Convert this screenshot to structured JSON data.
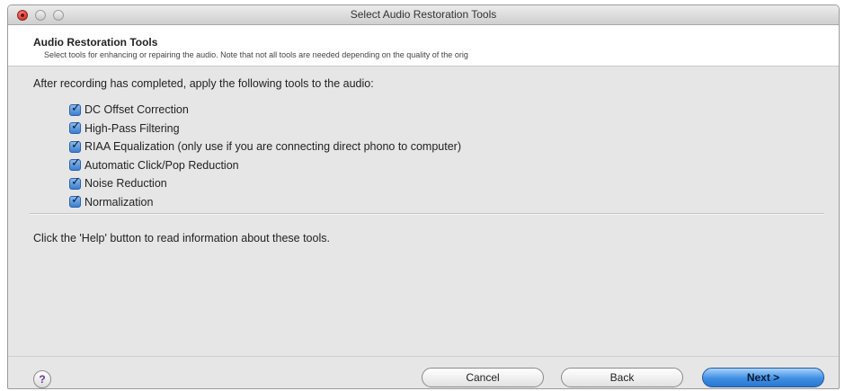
{
  "window": {
    "title": "Select Audio Restoration Tools"
  },
  "header": {
    "title": "Audio Restoration Tools",
    "subtitle": "Select tools for enhancing or repairing the audio. Note that not all tools are needed depending on the quality of the orig"
  },
  "instruction": "After recording has completed, apply the following tools to the audio:",
  "tools": [
    {
      "label": "DC Offset Correction",
      "checked": true
    },
    {
      "label": "High-Pass Filtering",
      "checked": true
    },
    {
      "label": "RIAA Equalization (only use if you are connecting direct phono to computer)",
      "checked": true
    },
    {
      "label": "Automatic Click/Pop Reduction",
      "checked": true
    },
    {
      "label": "Noise Reduction",
      "checked": true
    },
    {
      "label": "Normalization",
      "checked": true
    }
  ],
  "help_text": "Click the 'Help' button to read information about these tools.",
  "buttons": {
    "help": "?",
    "cancel": "Cancel",
    "back": "Back",
    "next": "Next >"
  },
  "colors": {
    "close_button": "#d3362c",
    "checkbox_accent": "#3b7fd0",
    "default_button": "#3e8fe4"
  }
}
